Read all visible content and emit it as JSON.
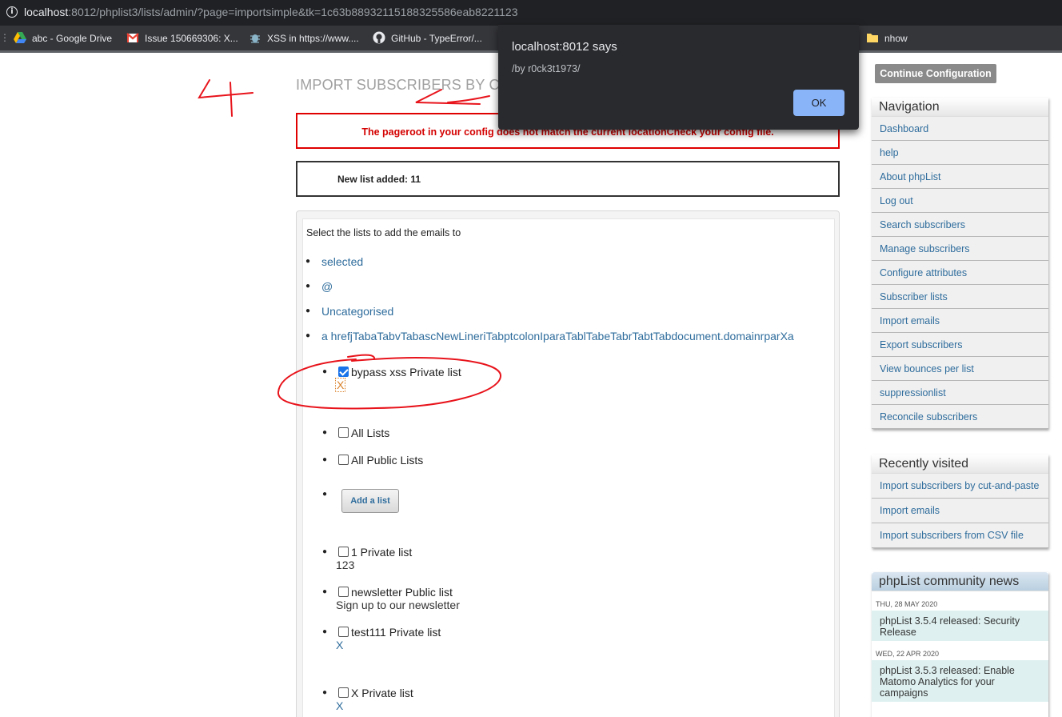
{
  "browser": {
    "url_host": "localhost",
    "url_rest": ":8012/phplist3/lists/admin/?page=importsimple&tk=1c63b88932115188325586eab8221123",
    "bookmarks": [
      {
        "label": "abc - Google Drive",
        "icon": "google-drive-icon"
      },
      {
        "label": "Issue 150669306: X...",
        "icon": "gmail-icon"
      },
      {
        "label": "XSS in https://www....",
        "icon": "bug-icon"
      },
      {
        "label": "GitHub - TypeError/...",
        "icon": "github-icon"
      },
      {
        "label": "nhow",
        "icon": "folder-icon"
      }
    ]
  },
  "alert": {
    "title": "localhost:8012 says",
    "message": "/by r0ck3t1973/",
    "ok_label": "OK"
  },
  "page": {
    "title": "IMPORT SUBSCRIBERS BY C",
    "error": "The pageroot in your config does not match the current locationCheck your config file.",
    "info": "New list added: 11",
    "lists_intro": "Select the lists to add the emails to",
    "category_links": [
      "selected",
      "@",
      "Uncategorised",
      "a hrefjTabaTabvTabascNewLineriTabptcolonIparaTablTabeTabrTabtTabdocument.domainrparXa"
    ],
    "checkbox_lists": [
      {
        "name": "bypass xss Private list",
        "desc": "X",
        "checked": true
      },
      {
        "name": "All Lists",
        "desc": "",
        "checked": false
      },
      {
        "name": "All Public Lists",
        "desc": "",
        "checked": false
      },
      {
        "name": "1 Private list",
        "desc": "123",
        "checked": false
      },
      {
        "name": "newsletter Public list",
        "desc": "Sign up to our newsletter",
        "checked": false
      },
      {
        "name": "test111 Private list",
        "desc": "X",
        "checked": false
      },
      {
        "name": "X Private list",
        "desc": "X",
        "checked": false
      }
    ],
    "add_list_label": "Add a list"
  },
  "sidebar": {
    "continue_label": "Continue Configuration",
    "navigation": {
      "title": "Navigation",
      "items": [
        "Dashboard",
        "help",
        "About phpList",
        "Log out",
        "Search subscribers",
        "Manage subscribers",
        "Configure attributes",
        "Subscriber lists",
        "Import emails",
        "Export subscribers",
        "View bounces per list",
        "suppressionlist",
        "Reconcile subscribers"
      ]
    },
    "recent": {
      "title": "Recently visited",
      "items": [
        "Import subscribers by cut-and-paste",
        "Import emails",
        "Import subscribers from CSV file"
      ]
    },
    "news": {
      "title": "phpList community news",
      "entries": [
        {
          "date": "THU, 28 MAY 2020",
          "text": "phpList 3.5.4 released: Security Release"
        },
        {
          "date": "WED, 22 APR 2020",
          "text": "phpList 3.5.3 released: Enable Matomo Analytics for your campaigns"
        }
      ]
    }
  },
  "annotation": {
    "number": "4",
    "color": "#e8141c"
  }
}
